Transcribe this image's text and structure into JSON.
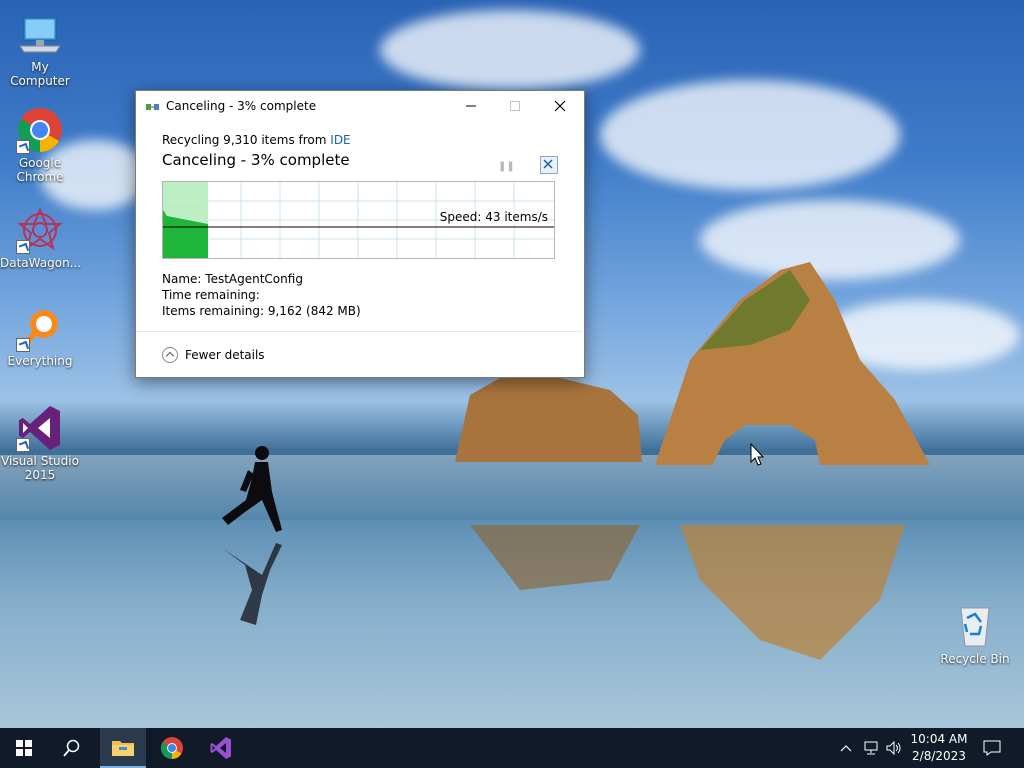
{
  "desktop": {
    "icons": [
      {
        "label": "My Computer"
      },
      {
        "label": "Google Chrome"
      },
      {
        "label": "DataWagon..."
      },
      {
        "label": "Everything"
      },
      {
        "label": "Visual Studio 2015"
      },
      {
        "label": "Recycle Bin"
      }
    ]
  },
  "dialog": {
    "title": "Canceling - 3% complete",
    "source_prefix": "Recycling 9,310 items from ",
    "source_name": "IDE",
    "headline": "Canceling - 3% complete",
    "speed": "Speed: 43 items/s",
    "progress_fraction": 0.03,
    "name_label": "Name:",
    "name_value": "TestAgentConfig",
    "time_label": "Time remaining:",
    "time_value": "",
    "items_label": "Items remaining:",
    "items_value": "9,162 (842 MB)",
    "fewer_details": "Fewer details"
  },
  "taskbar": {
    "time": "10:04 AM",
    "date": "2/8/2023"
  },
  "colors": {
    "progress_green": "#1fb53a",
    "progress_light": "#bdeec3",
    "taskbar": "#101a28",
    "link": "#1a5fb4"
  }
}
